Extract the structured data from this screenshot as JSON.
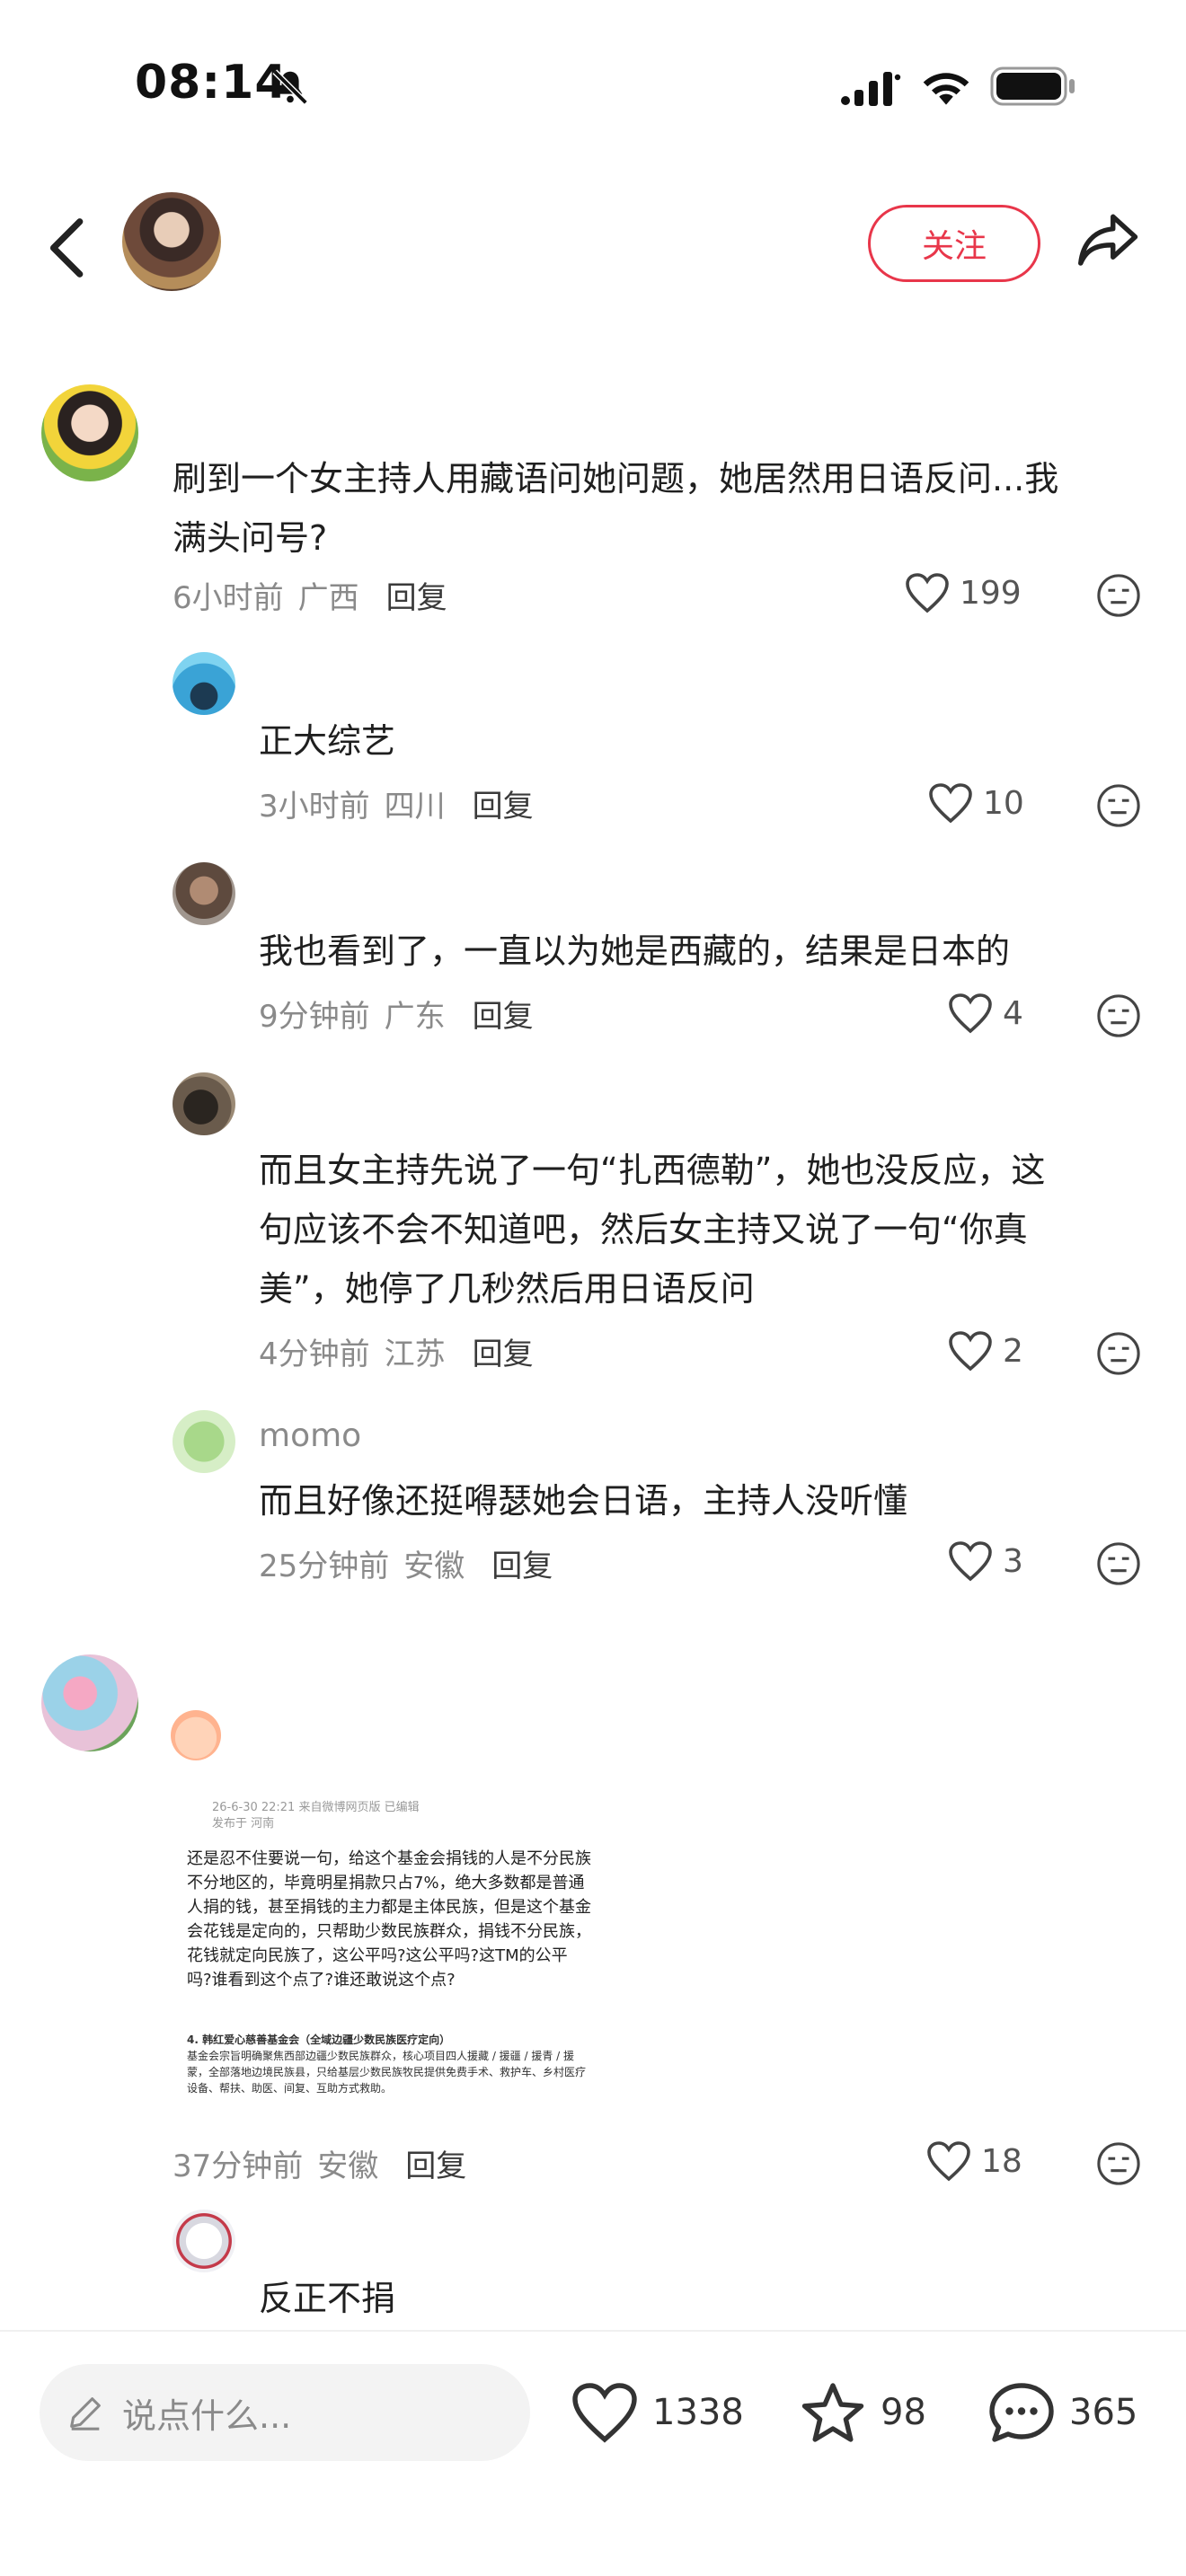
{
  "status": {
    "time": "08:14"
  },
  "header": {
    "follow_label": "关注"
  },
  "comments": [
    {
      "text_line1": "刷到一个女主持人用藏语问她问题，她居然用日语反问...我",
      "text_line2": "满头问号?",
      "time": "6小时前",
      "location": "广西",
      "reply": "回复",
      "likes": "199",
      "replies": [
        {
          "text": "正大综艺",
          "time": "3小时前",
          "location": "四川",
          "reply": "回复",
          "likes": "10"
        },
        {
          "text": "我也看到了，一直以为她是西藏的，结果是日本的",
          "time": "9分钟前",
          "location": "广东",
          "reply": "回复",
          "likes": "4"
        },
        {
          "text_line1": "而且女主持先说了一句“扎西德勒”，她也没反应，这",
          "text_line2": "句应该不会不知道吧，然后女主持又说了一句“你真",
          "text_line3": "美”，她停了几秒然后用日语反问",
          "time": "4分钟前",
          "location": "江苏",
          "reply": "回复",
          "likes": "2"
        },
        {
          "username": "momo",
          "text": "而且好像还挺嘚瑟她会日语，主持人没听懂",
          "time": "25分钟前",
          "location": "安徽",
          "reply": "回复",
          "likes": "3"
        }
      ]
    },
    {
      "image": {
        "head_line1": "26-6-30 22:21  来自微博网页版  已编辑",
        "head_line2": "发布于 河南",
        "body": "还是忍不住要说一句，给这个基金会捐钱的人是不分民族不分地区的，毕竟明星捐款只占7%，绝大多数都是普通人捐的钱，甚至捐钱的主力都是主体民族，但是这个基金会花钱是定向的，只帮助少数民族群众，捐钱不分民族，花钱就定向民族了，这公平吗?这公平吗?这TM的公平吗?谁看到这个点了?谁还敢说这个点?",
        "sub_title": "4. 韩红爱心慈善基金会（全域边疆少数民族医疗定向）",
        "sub_body": "基金会宗旨明确聚焦西部边疆少数民族群众，核心项目四人援藏 / 援疆 / 援青 / 援蒙，全部落地边境民族县，只给基层少数民族牧民提供免费手术、救护车、乡村医疗设备、帮扶、助医、间复、互助方式救助。"
      },
      "time": "37分钟前",
      "location": "安徽",
      "reply": "回复",
      "likes": "18",
      "replies": [
        {
          "text": "反正不捐"
        }
      ]
    }
  ],
  "bottom": {
    "input_placeholder": "说点什么...",
    "likes": "1338",
    "stars": "98",
    "comments": "365"
  },
  "colors": {
    "accent": "#e8364a",
    "muted": "#8a8a8a"
  }
}
